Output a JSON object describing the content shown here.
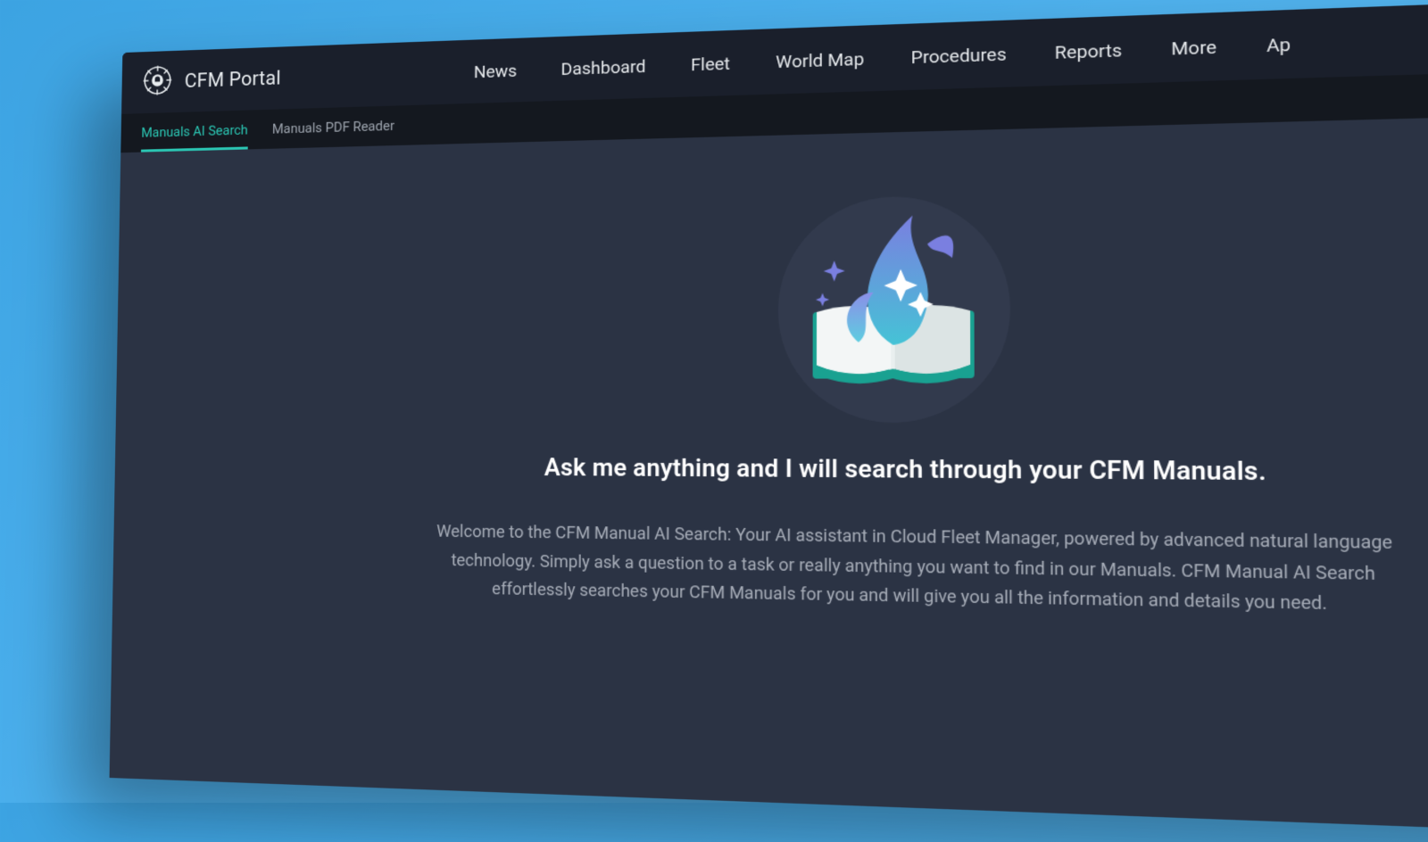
{
  "colors": {
    "accent": "#2bc7b4",
    "header_bg": "#1a1f2b",
    "subnav_bg": "#14181f",
    "content_bg": "#2b3344",
    "page_gradient_from": "#3ca3e2",
    "page_gradient_to": "#5bb8ef"
  },
  "header": {
    "title": "CFM Portal",
    "nav": [
      "News",
      "Dashboard",
      "Fleet",
      "World Map",
      "Procedures",
      "Reports",
      "More",
      "Ap"
    ]
  },
  "tabs": [
    {
      "label": "Manuals AI Search",
      "active": true
    },
    {
      "label": "Manuals PDF Reader",
      "active": false
    }
  ],
  "hero": {
    "icon": "magic-book-icon",
    "headline": "Ask me anything and I will search through your CFM Manuals.",
    "body": "Welcome to the CFM Manual AI Search: Your AI assistant in Cloud Fleet Manager, powered by advanced natural language technology. Simply ask a question to a task or really anything you want to find in our Manuals. CFM Manual AI Search effortlessly searches your CFM Manuals for you and will give you all the information and details you need."
  }
}
